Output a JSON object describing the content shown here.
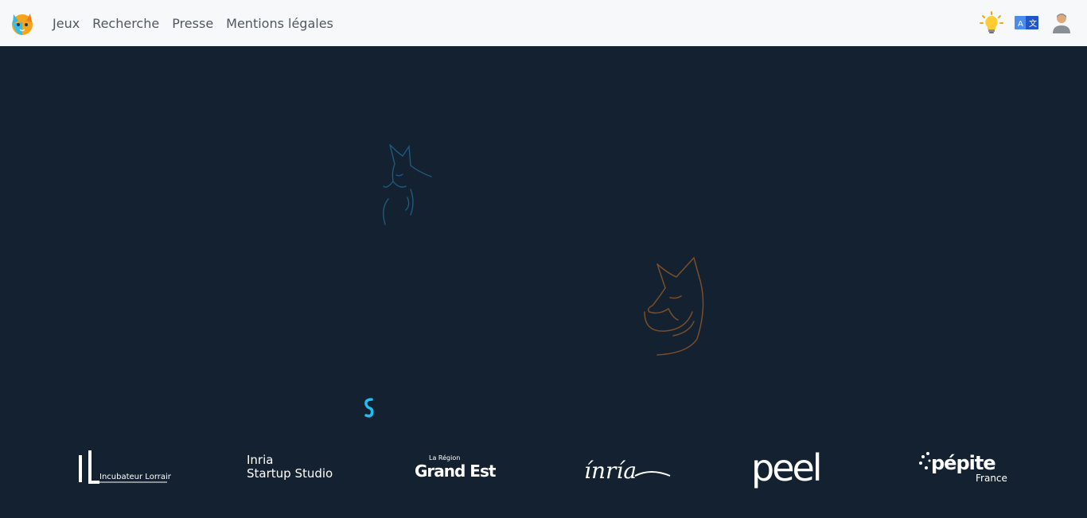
{
  "navbar": {
    "brand_icon": "fox-logo-icon",
    "links": [
      {
        "label": "Jeux"
      },
      {
        "label": "Recherche"
      },
      {
        "label": "Presse"
      },
      {
        "label": "Mentions légales"
      }
    ],
    "right_icons": [
      "lightbulb-icon",
      "translate-icon",
      "user-icon"
    ]
  },
  "hero": {
    "illustrations": [
      "fox-blue-illustration",
      "fox-orange-illustration"
    ],
    "loading_indicator": "spinner-icon"
  },
  "partners": [
    {
      "name": "Incubateur Lorrain",
      "mark": "IL",
      "text": "Incubateur Lorrain"
    },
    {
      "name": "Inria Startup Studio",
      "line1": "Inria",
      "line2": "Startup Studio"
    },
    {
      "name": "La Région Grand Est",
      "line1": "La Région",
      "line2": "Grand Est"
    },
    {
      "name": "Inria",
      "text": "ínría"
    },
    {
      "name": "PEEL",
      "text": "peel"
    },
    {
      "name": "Pépite France",
      "line1": "pépite",
      "line2": "France"
    }
  ],
  "colors": {
    "navbar_bg": "#f7f8fa",
    "page_bg": "#132131",
    "nav_text": "#505760",
    "fox_blue": "#1d5a7e",
    "fox_orange": "#7a4e2a",
    "spinner": "#1fc0f0",
    "logo_white": "#ffffff"
  }
}
